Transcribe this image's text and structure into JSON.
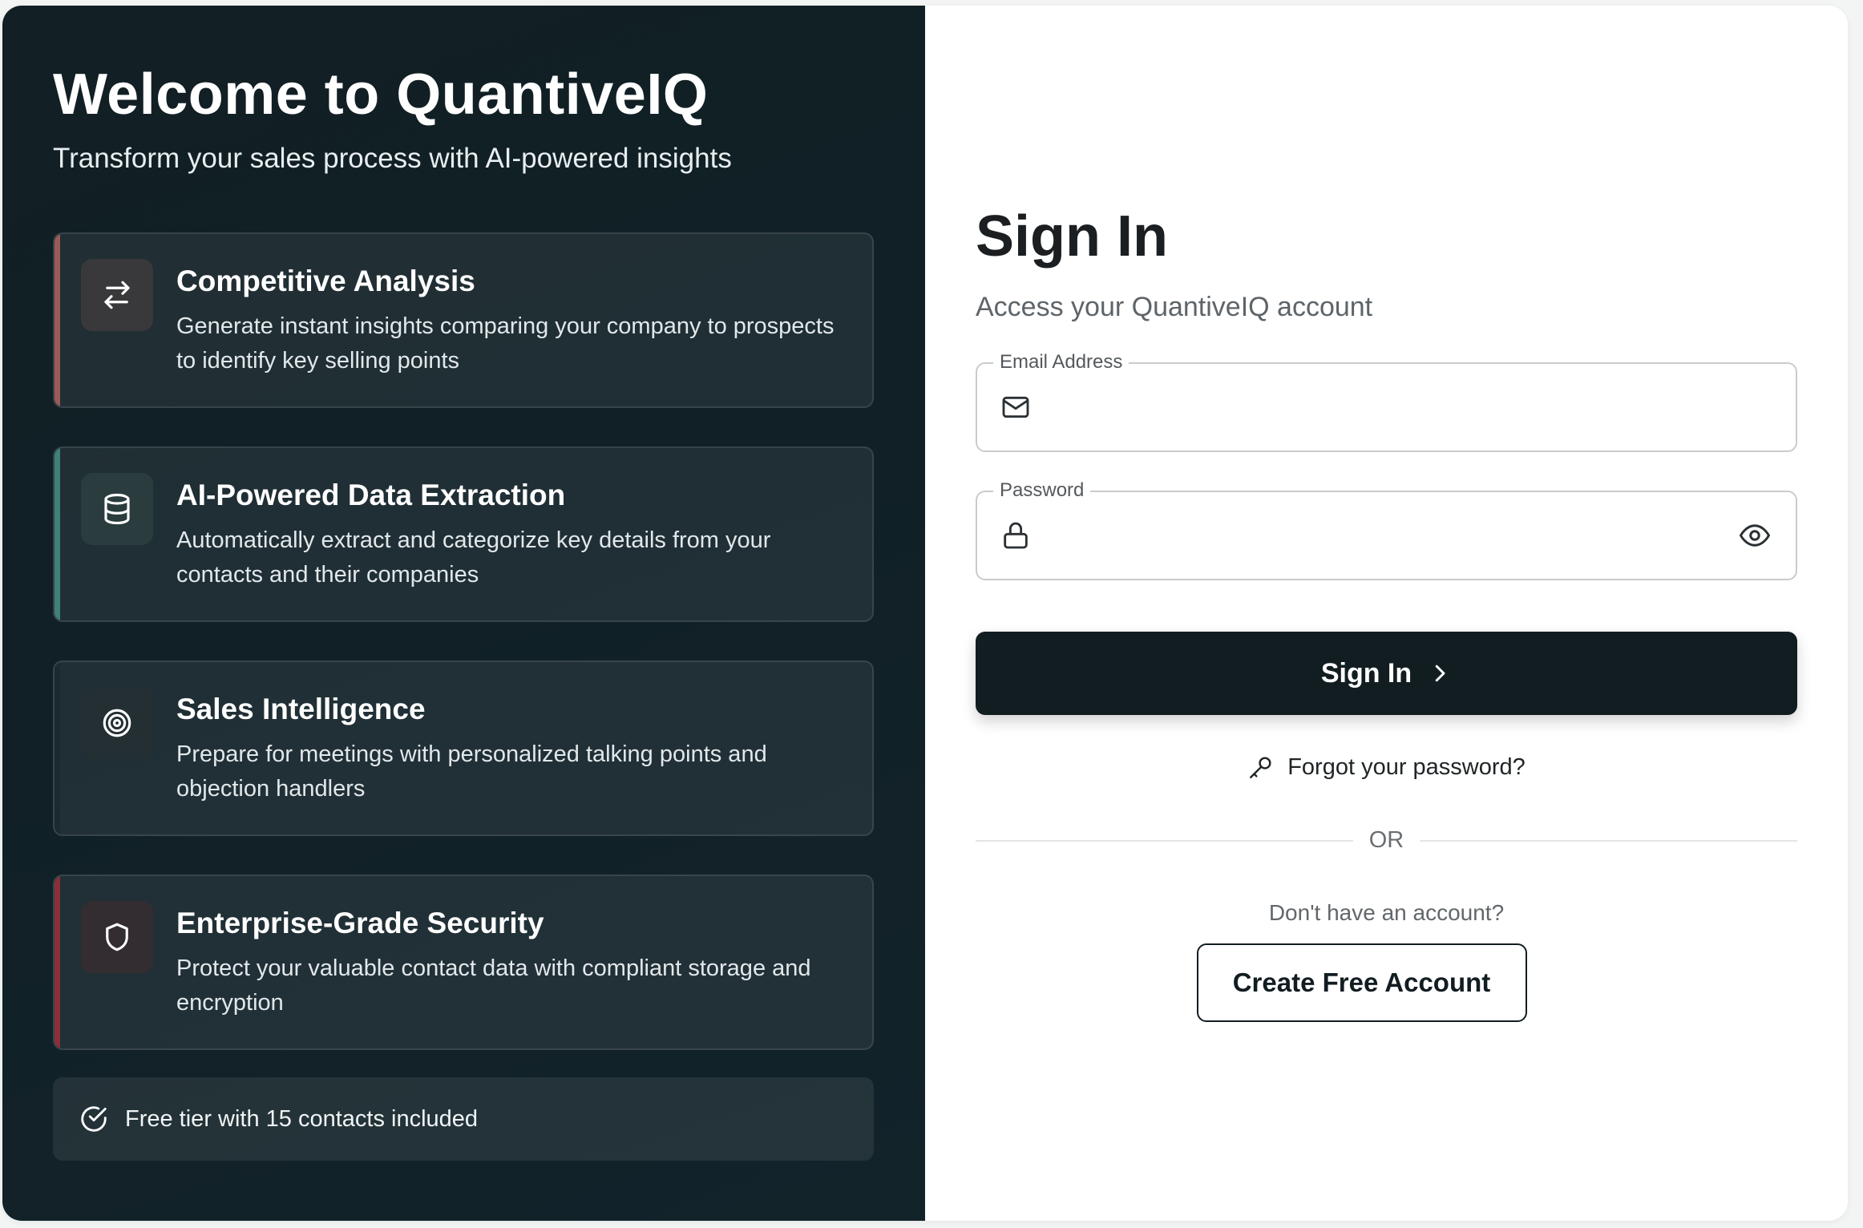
{
  "hero": {
    "title": "Welcome to QuantiveIQ",
    "tagline": "Transform your sales process with AI-powered insights"
  },
  "features": [
    {
      "title": "Competitive Analysis",
      "description": "Generate instant insights comparing your company to prospects to identify key selling points",
      "icon": "arrows-exchange-icon",
      "accent": "#9b5a58"
    },
    {
      "title": "AI-Powered Data Extraction",
      "description": "Automatically extract and categorize key details from your contacts and their companies",
      "icon": "database-icon",
      "accent": "#3f8178"
    },
    {
      "title": "Sales Intelligence",
      "description": "Prepare for meetings with personalized talking points and objection handlers",
      "icon": "target-icon",
      "accent": "#1a2a31"
    },
    {
      "title": "Enterprise-Grade Security",
      "description": "Protect your valuable contact data with compliant storage and encryption",
      "icon": "shield-icon",
      "accent": "#8a2e3a"
    }
  ],
  "free_tier": {
    "text": "Free tier with 15 contacts included",
    "icon": "check-circle-icon"
  },
  "signin": {
    "title": "Sign In",
    "subtitle": "Access your QuantiveIQ account",
    "email_label": "Email Address",
    "email_value": "",
    "password_label": "Password",
    "password_value": "",
    "submit_label": "Sign In",
    "forgot_label": "Forgot your password?",
    "or_label": "OR",
    "no_account_label": "Don't have an account?",
    "create_label": "Create Free Account"
  }
}
